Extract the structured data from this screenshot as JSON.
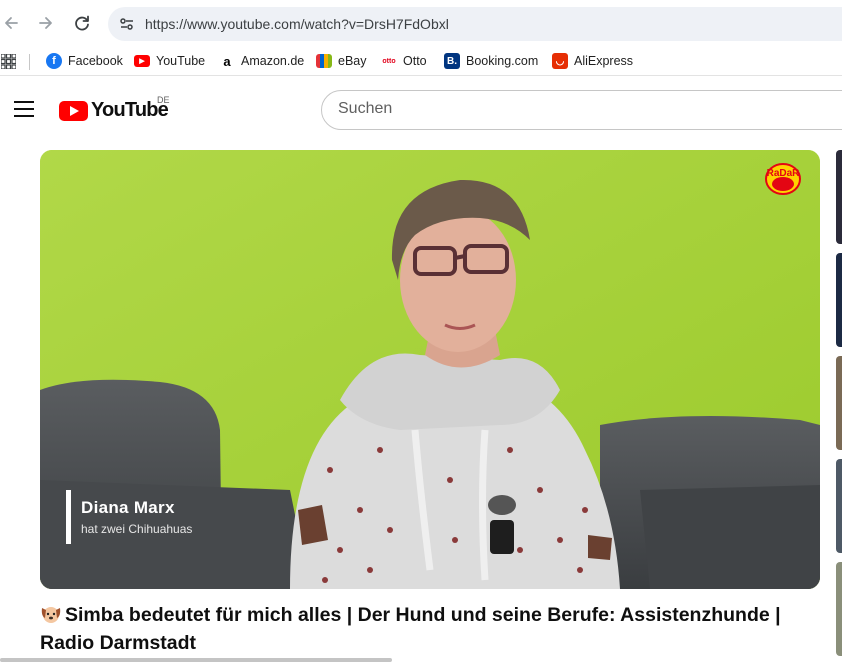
{
  "browser": {
    "url": "https://www.youtube.com/watch?v=DrsH7FdObxl",
    "bookmarks": [
      {
        "label": "Facebook",
        "icon": "facebook-icon",
        "color": "#1877f2"
      },
      {
        "label": "YouTube",
        "icon": "youtube-icon",
        "color": "#ff0000"
      },
      {
        "label": "Amazon.de",
        "icon": "amazon-icon",
        "color": "#000000"
      },
      {
        "label": "eBay",
        "icon": "ebay-icon",
        "color": "#e53238"
      },
      {
        "label": "Otto",
        "icon": "otto-icon",
        "color": "#e2001a"
      },
      {
        "label": "Booking.com",
        "icon": "booking-icon",
        "color": "#003580"
      },
      {
        "label": "AliExpress",
        "icon": "aliexpress-icon",
        "color": "#e62e04"
      }
    ]
  },
  "youtube": {
    "logo_text": "YouTube",
    "region": "DE",
    "search_placeholder": "Suchen"
  },
  "video": {
    "overlay_name": "Diana Marx",
    "overlay_subtitle": "hat zwei Chihuahuas",
    "channel_logo_text": "RaDaR",
    "title": "Simba bedeutet für mich alles | Der Hund und seine Berufe: Assistenzhunde | Radio Darmstadt",
    "title_emoji": "dog-face-icon"
  },
  "colors": {
    "yt_red": "#ff0000",
    "wall_green": "#a9d33a"
  }
}
